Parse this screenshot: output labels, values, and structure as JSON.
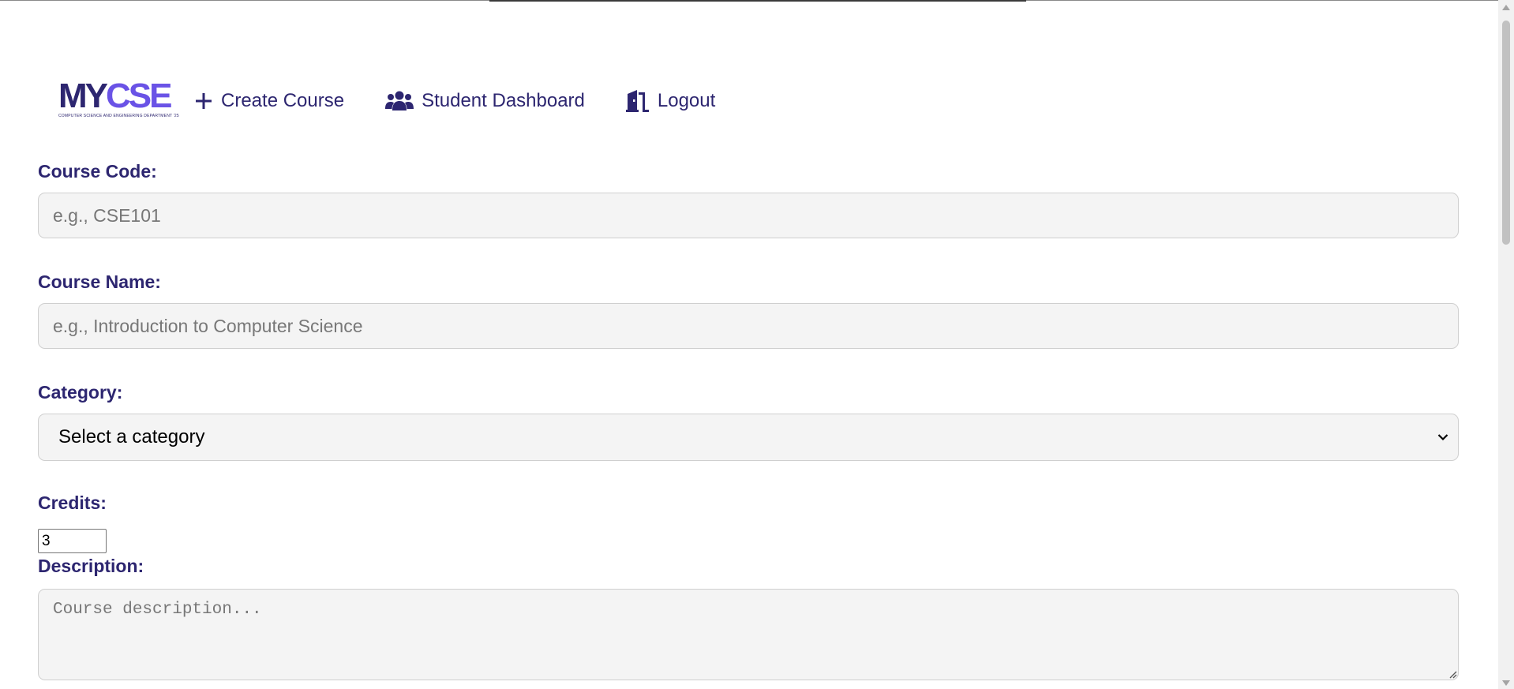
{
  "logo": {
    "primary": "MY",
    "accent": "CSE",
    "subtitle": "COMPUTER SCIENCE AND ENGINEERING DEPARTMENT '25"
  },
  "nav": {
    "create_course": "Create Course",
    "student_dashboard": "Student Dashboard",
    "logout": "Logout"
  },
  "form": {
    "course_code": {
      "label": "Course Code:",
      "placeholder": "e.g., CSE101",
      "value": ""
    },
    "course_name": {
      "label": "Course Name:",
      "placeholder": "e.g., Introduction to Computer Science",
      "value": ""
    },
    "category": {
      "label": "Category:",
      "selected": "Select a category"
    },
    "credits": {
      "label": "Credits:",
      "value": "3"
    },
    "description": {
      "label": "Description:",
      "placeholder": "Course description..."
    }
  },
  "colors": {
    "brand": "#2d2670",
    "accent": "#6a53e6",
    "field_bg": "#f4f4f4"
  },
  "icons": {
    "create_course": "plus-icon",
    "student_dashboard": "users-icon",
    "logout": "door-exit-icon",
    "select": "chevron-down-icon"
  }
}
